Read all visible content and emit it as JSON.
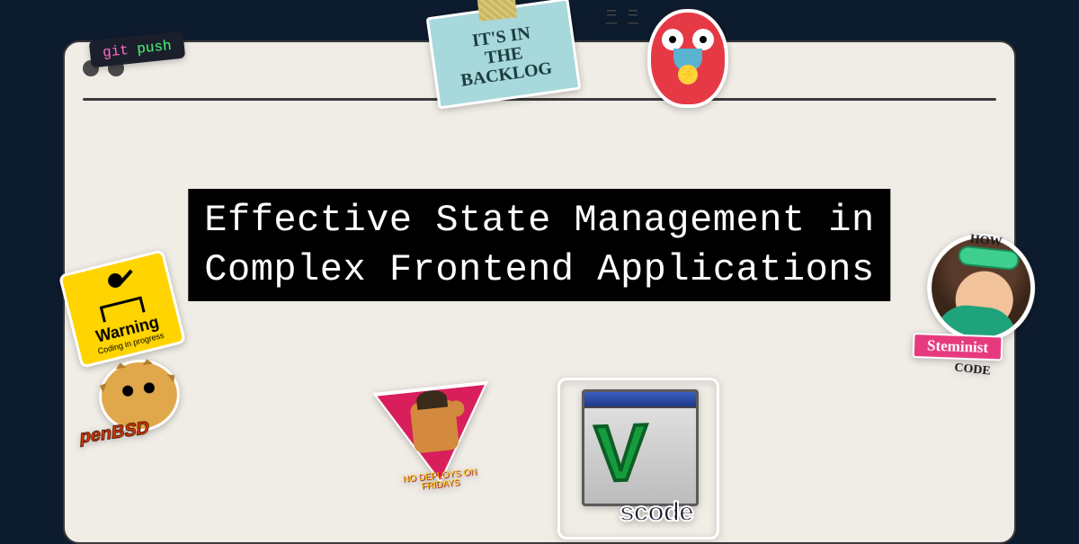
{
  "title": "Effective State Management in\nComplex Frontend Applications",
  "colors": {
    "page_bg": "#0d1b2e",
    "window_bg": "#f0ece6",
    "title_bg": "#000000",
    "title_fg": "#ffffff"
  },
  "stickers": {
    "git_push": {
      "command": "git",
      "arg": "push"
    },
    "backlog": {
      "line1": "IT'S IN",
      "line2": "THE BACKLOG"
    },
    "gopher": {
      "name": "go-gopher-flash"
    },
    "warning": {
      "title": "Warning",
      "subtitle": "Coding in progress"
    },
    "openbsd": {
      "text": "penBSD"
    },
    "fridays": {
      "line1": "NO DEPLOYS ON",
      "line2": "FRIDAYS"
    },
    "vscode": {
      "v": "V",
      "rest": "scode"
    },
    "steminist": {
      "ring_top": "HOW",
      "ring_bottom": "CODE",
      "banner": "Steminist"
    }
  }
}
